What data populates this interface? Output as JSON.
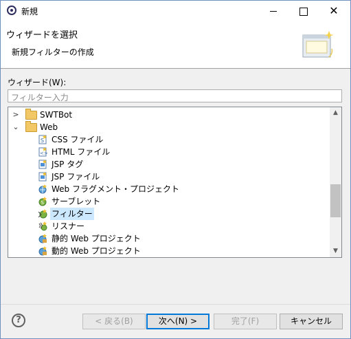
{
  "window": {
    "title": "新規"
  },
  "header": {
    "title": "ウィザードを選択",
    "description": "新規フィルターの作成"
  },
  "wizards": {
    "label": "ウィザード(W):",
    "filter_placeholder": "フィルター入力"
  },
  "tree": {
    "items": [
      {
        "label": "SWTBot",
        "icon": "folder-icon",
        "expanded": false
      },
      {
        "label": "Web",
        "icon": "folder-icon",
        "expanded": true
      },
      {
        "label": "CSS ファイル",
        "icon": "css-file-icon"
      },
      {
        "label": "HTML ファイル",
        "icon": "html-file-icon"
      },
      {
        "label": "JSP タグ",
        "icon": "jsp-tag-icon"
      },
      {
        "label": "JSP ファイル",
        "icon": "jsp-file-icon"
      },
      {
        "label": "Web フラグメント・プロジェクト",
        "icon": "web-fragment-project-icon"
      },
      {
        "label": "サーブレット",
        "icon": "servlet-icon"
      },
      {
        "label": "フィルター",
        "icon": "filter-icon",
        "selected": true
      },
      {
        "label": "リスナー",
        "icon": "listener-icon"
      },
      {
        "label": "静的 Web プロジェクト",
        "icon": "static-web-project-icon"
      },
      {
        "label": "動的 Web プロジェクト",
        "icon": "dynamic-web-project-icon"
      }
    ]
  },
  "buttons": {
    "back": "< 戻る(B)",
    "next": "次へ(N) >",
    "finish": "完了(F)",
    "cancel": "キャンセル"
  },
  "colors": {
    "selection": "#cce8ff",
    "folder": "#f2c766",
    "default_border": "#0078d7"
  }
}
